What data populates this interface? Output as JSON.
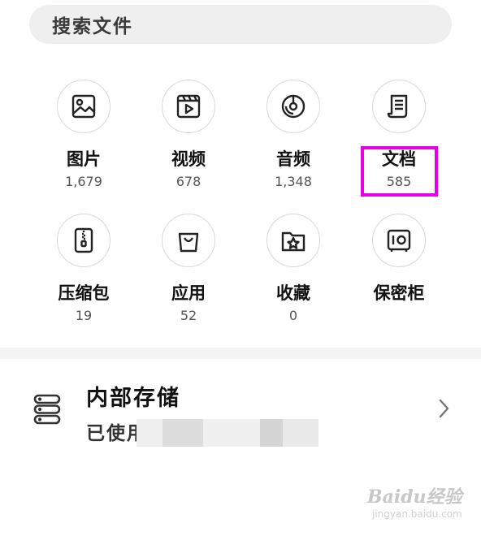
{
  "search": {
    "placeholder": "搜索文件"
  },
  "categories": [
    {
      "label": "图片",
      "count": "1,679",
      "icon": "image-icon"
    },
    {
      "label": "视频",
      "count": "678",
      "icon": "video-icon"
    },
    {
      "label": "音频",
      "count": "1,348",
      "icon": "audio-icon"
    },
    {
      "label": "文档",
      "count": "585",
      "icon": "document-icon"
    },
    {
      "label": "压缩包",
      "count": "19",
      "icon": "archive-icon"
    },
    {
      "label": "应用",
      "count": "52",
      "icon": "app-bag-icon"
    },
    {
      "label": "收藏",
      "count": "0",
      "icon": "star-folder-icon"
    },
    {
      "label": "保密柜",
      "count": "",
      "icon": "safe-icon"
    }
  ],
  "storage": {
    "title": "内部存储",
    "subtitle_prefix": "已使用",
    "icon": "storage-icon"
  },
  "watermark": {
    "text": "Baidu经验",
    "sub": "jingyan.baidu.com"
  },
  "colors": {
    "highlight": "#e600e6",
    "search_bg": "#efefef"
  }
}
